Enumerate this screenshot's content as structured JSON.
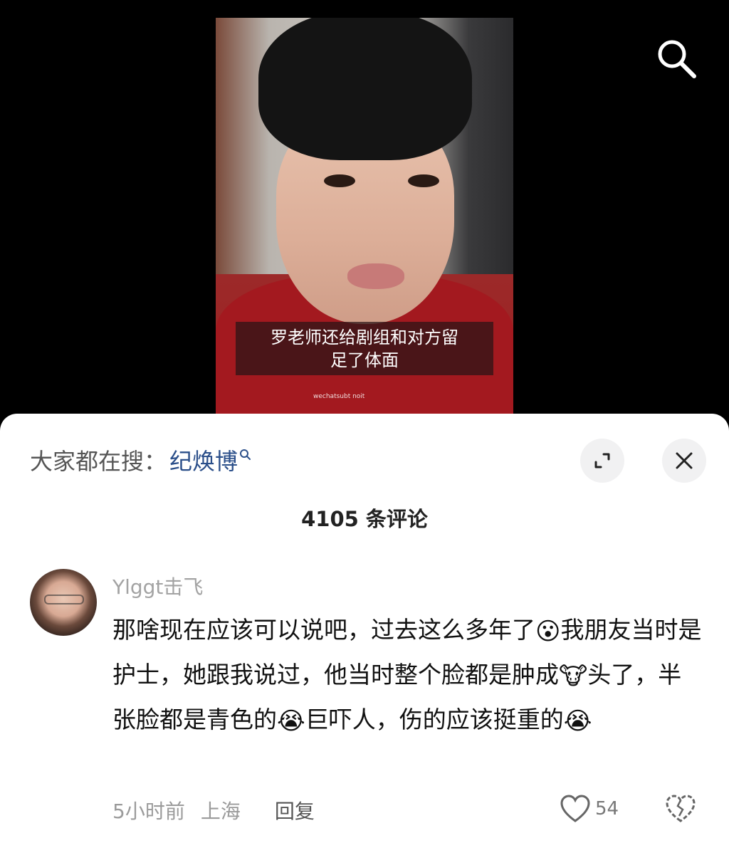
{
  "video": {
    "subtitle_line1": "罗老师还给剧组和对方留",
    "subtitle_line2": "足了体面",
    "shirt_text": "wechatsubt noit"
  },
  "top_bar": {
    "search_icon": "search-icon"
  },
  "sheet": {
    "trending_prefix": "大家都在搜：",
    "trending_term": "纪焕博",
    "expand_icon": "expand-icon",
    "close_icon": "close-icon",
    "comment_count": "4105 条评论"
  },
  "comment": {
    "username": "Ylggt击飞",
    "text_part1": "那啥现在应该可以说吧，过去这么多年了",
    "emoji1": "😮",
    "text_part2": "我朋友当时是护士，她跟我说过，他当时整个脸都是肿成",
    "emoji2": "🐮",
    "text_part3": "头了，半张脸都是青色的",
    "emoji3": "😭",
    "text_part4": "巨吓人，伤的应该挺重的",
    "emoji4": "😭",
    "time": "5小时前",
    "location": "上海",
    "reply_label": "回复",
    "like_count": "54",
    "like_icon": "heart-icon",
    "dislike_icon": "broken-heart-icon"
  },
  "colors": {
    "accent_link": "#2b4f8a",
    "muted_text": "#9b9b9b"
  }
}
